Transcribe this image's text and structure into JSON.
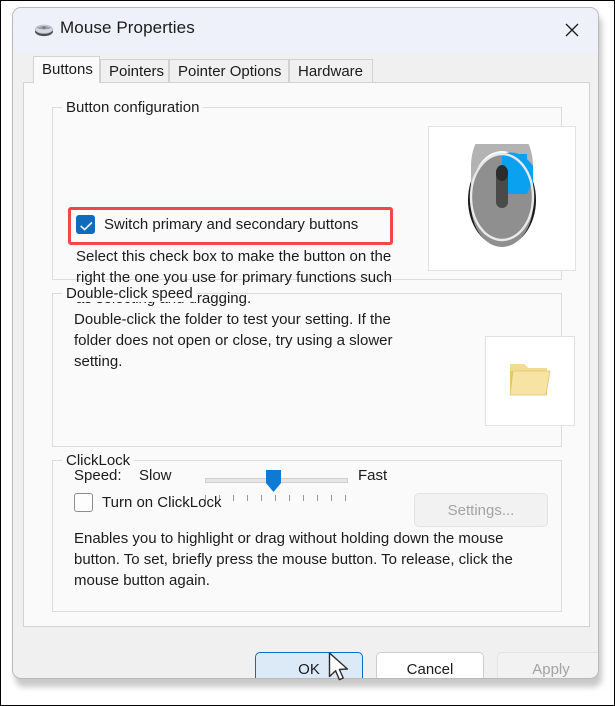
{
  "window": {
    "title": "Mouse Properties",
    "icon": "mouse-icon",
    "close_label": "✕"
  },
  "tabs": [
    {
      "label": "Buttons",
      "active": true
    },
    {
      "label": "Pointers",
      "active": false
    },
    {
      "label": "Pointer Options",
      "active": false
    },
    {
      "label": "Hardware",
      "active": false
    }
  ],
  "button_configuration": {
    "title": "Button configuration",
    "checkbox": {
      "label": "Switch primary and secondary buttons",
      "checked": true,
      "highlighted": true
    },
    "description": "Select this check box to make the button on the right the one you use for primary functions such as selecting and dragging.",
    "preview_image": "mouse-illustration"
  },
  "double_click_speed": {
    "title": "Double-click speed",
    "description": "Double-click the folder to test your setting. If the folder does not open or close, try using a slower setting.",
    "speed_label": "Speed:",
    "slow_label": "Slow",
    "fast_label": "Fast",
    "slider_value": 5,
    "slider_min": 0,
    "slider_max": 10,
    "tick_count": 11,
    "test_image": "folder-icon"
  },
  "clicklock": {
    "title": "ClickLock",
    "checkbox": {
      "label": "Turn on ClickLock",
      "checked": false
    },
    "settings_button": {
      "label": "Settings...",
      "enabled": false
    },
    "description": "Enables you to highlight or drag without holding down the mouse button. To set, briefly press the mouse button. To release, click the mouse button again."
  },
  "footer": {
    "ok_label": "OK",
    "cancel_label": "Cancel",
    "apply_label": "Apply",
    "ok_is_default": true,
    "apply_enabled": false
  },
  "colors": {
    "accent": "#0f6cbd",
    "annotation": "#f0474a",
    "titlebar": "#eef1fa",
    "dialog_bg": "#f0f0f0",
    "panel_bg": "#fafafa",
    "mouse_highlight": "#0aa2f0",
    "folder": "#f5d97a"
  }
}
